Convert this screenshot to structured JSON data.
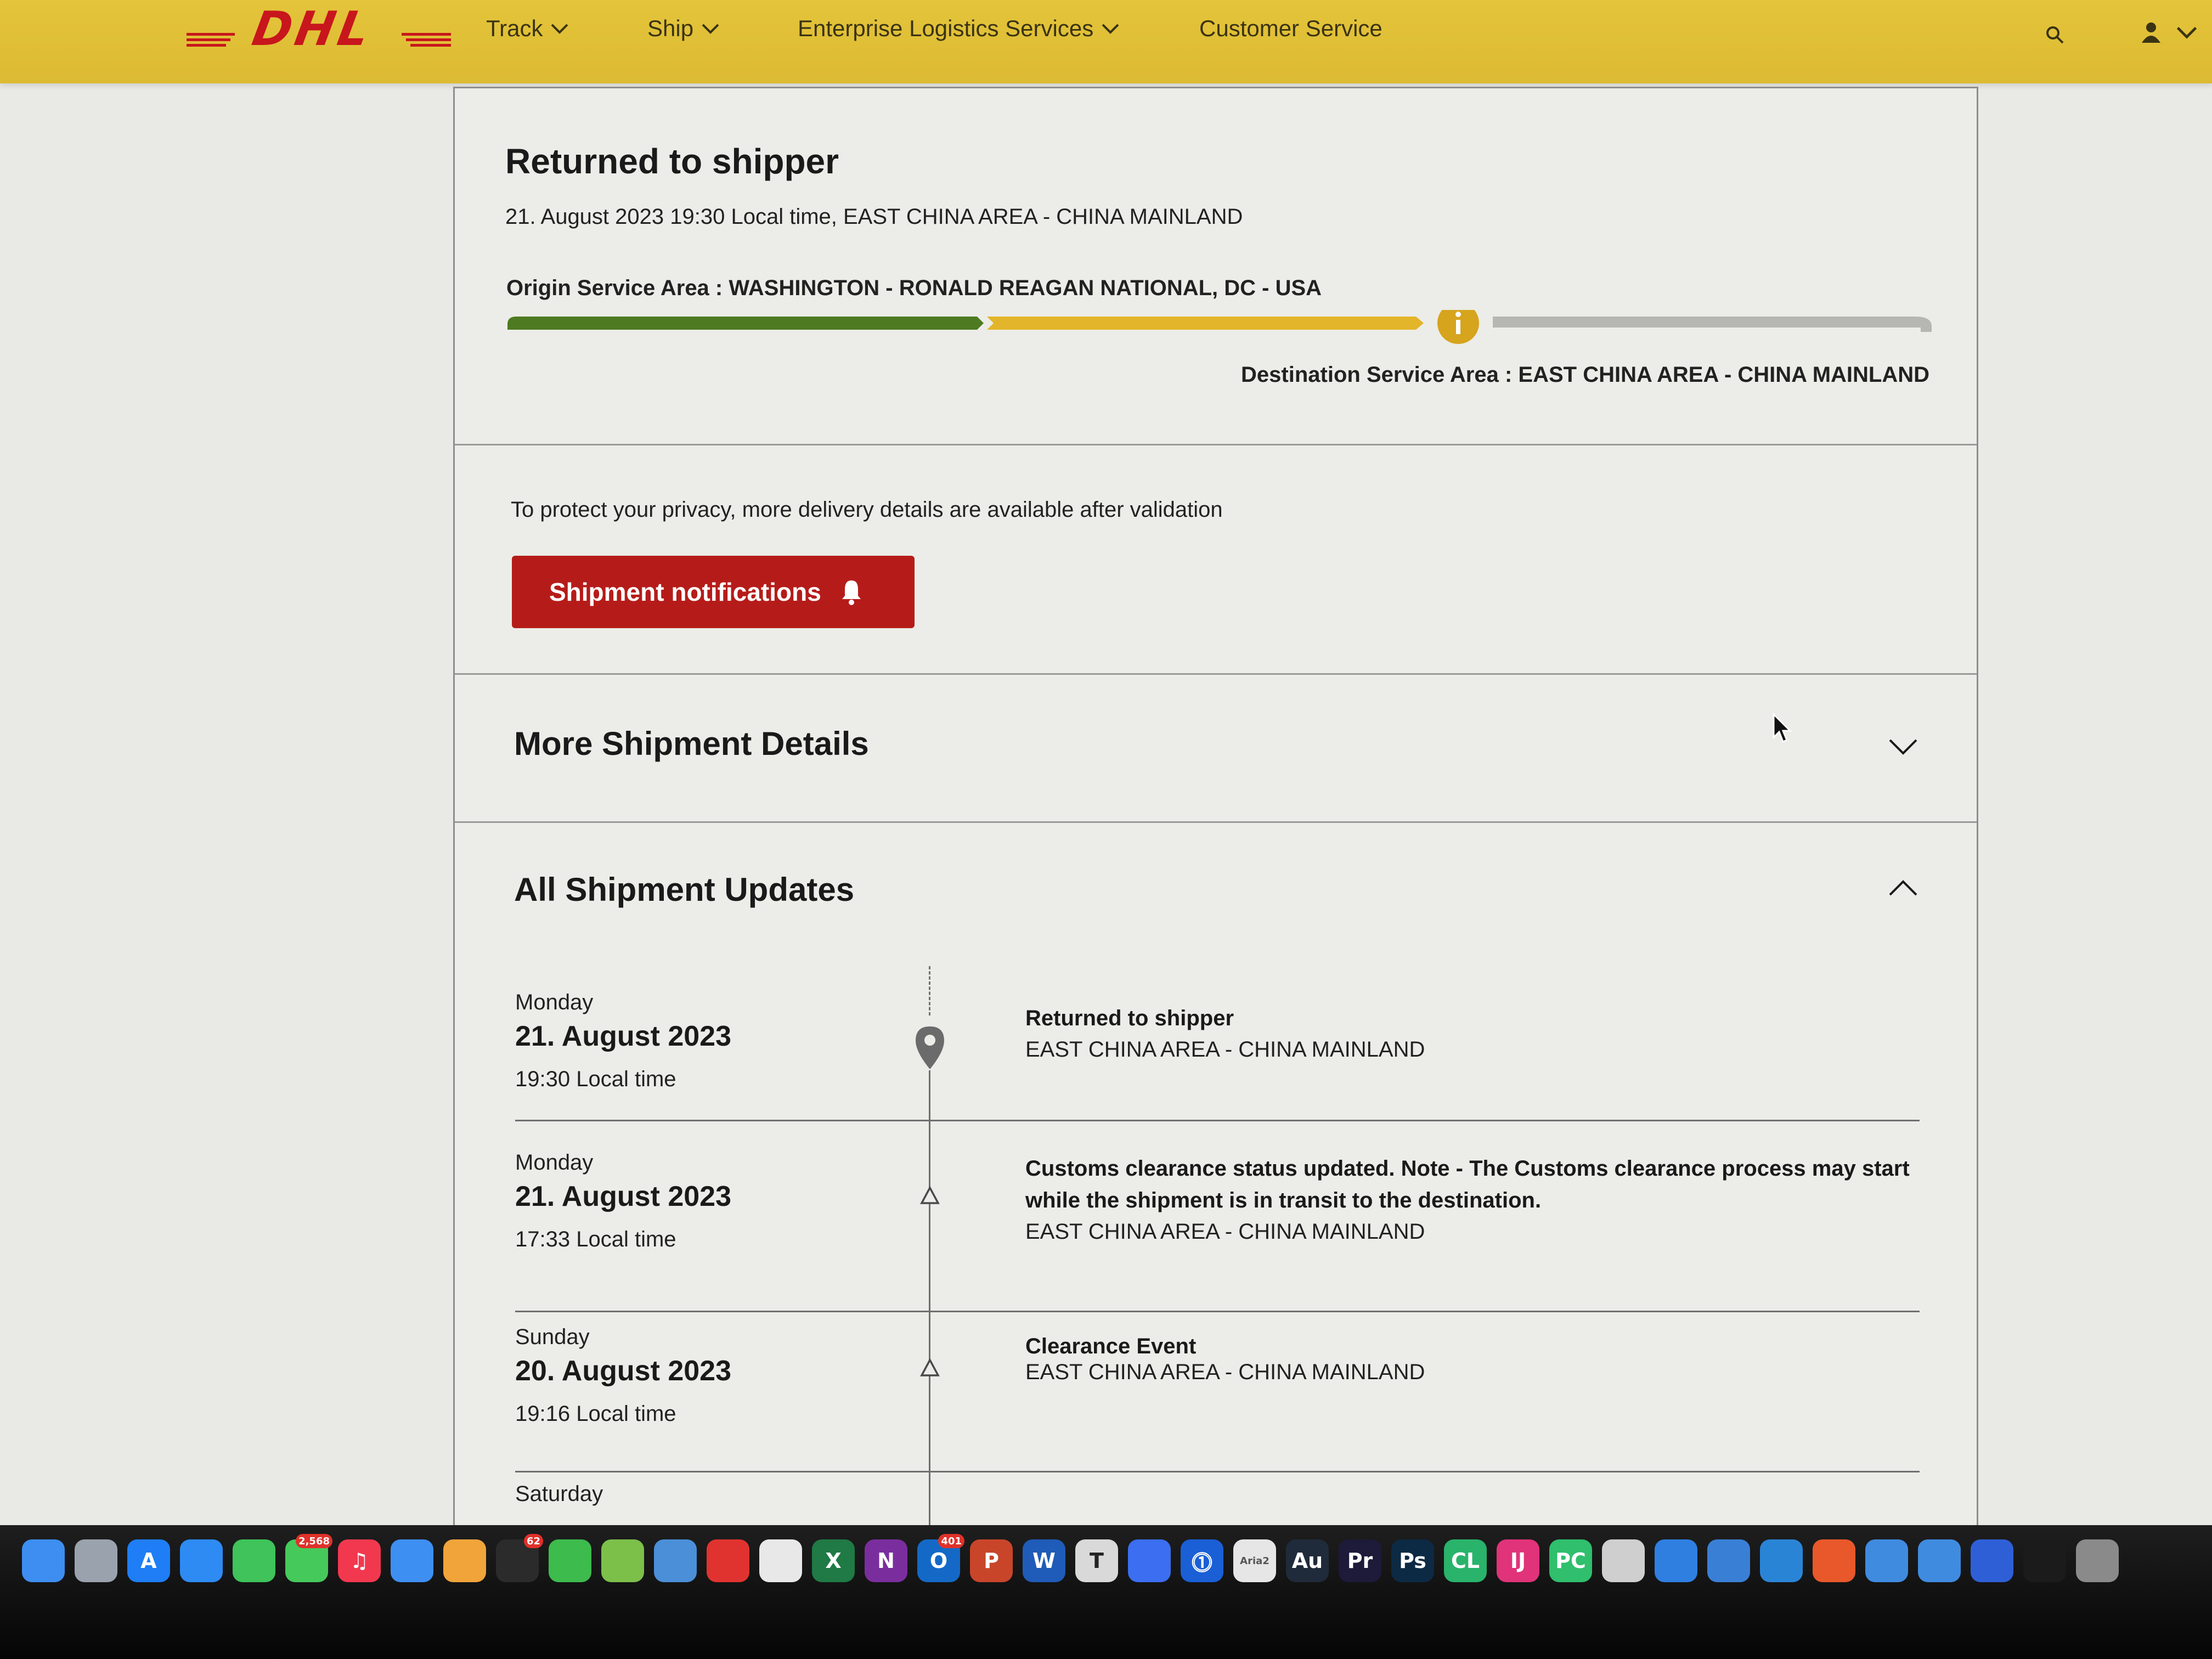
{
  "nav": {
    "logo_text": "DHL",
    "items": [
      {
        "label": "Track"
      },
      {
        "label": "Ship"
      },
      {
        "label": "Enterprise Logistics Services"
      },
      {
        "label": "Customer Service"
      }
    ]
  },
  "status": {
    "title": "Returned to shipper",
    "subtitle": "21. August 2023 19:30 Local time, EAST CHINA AREA - CHINA MAINLAND",
    "origin": "Origin Service Area : WASHINGTON - RONALD REAGAN NATIONAL, DC - USA",
    "destination": "Destination Service Area : EAST CHINA AREA - CHINA MAINLAND",
    "progress_segments": [
      "complete",
      "in-transit",
      "pending"
    ],
    "colors": {
      "complete": "#4e7a22",
      "in_transit": "#e3b52b",
      "pending": "#b6b6b3",
      "info": "#d6a41d"
    }
  },
  "privacy": {
    "text": "To protect your privacy, more delivery details are available after validation",
    "button_label": "Shipment notifications",
    "button_color": "#b51c19"
  },
  "sections": {
    "details_title": "More Shipment Details",
    "updates_title": "All Shipment Updates"
  },
  "events": [
    {
      "day": "Monday",
      "date": "21. August 2023",
      "time": "19:30 Local time",
      "title": "Returned to shipper",
      "location": "EAST CHINA AREA - CHINA MAINLAND",
      "icon": "location-pin-icon"
    },
    {
      "day": "Monday",
      "date": "21. August 2023",
      "time": "17:33 Local time",
      "title": "Customs clearance status updated. Note - The Customs clearance process may start while the shipment is in transit to the destination.",
      "location": "EAST CHINA AREA - CHINA MAINLAND",
      "icon": "triangle-icon"
    },
    {
      "day": "Sunday",
      "date": "20. August 2023",
      "time": "19:16 Local time",
      "title": "Clearance Event",
      "location": "EAST CHINA AREA - CHINA MAINLAND",
      "icon": "triangle-icon"
    },
    {
      "day": "Saturday",
      "date": "",
      "time": "",
      "title": "",
      "location": "",
      "icon": "triangle-icon"
    }
  ],
  "dock": {
    "apps": [
      {
        "name": "finder-icon",
        "color": "#3d8ef0",
        "glyph": ""
      },
      {
        "name": "launchpad-icon",
        "color": "#9aa3ad",
        "glyph": ""
      },
      {
        "name": "app-store-icon",
        "color": "#1f7ef5",
        "glyph": "A"
      },
      {
        "name": "safari-icon",
        "color": "#2d8bf3",
        "glyph": ""
      },
      {
        "name": "facetime-icon",
        "color": "#3fc35a",
        "glyph": ""
      },
      {
        "name": "messages-icon",
        "color": "#46c95b",
        "glyph": "",
        "badge": "2,568"
      },
      {
        "name": "music-icon",
        "color": "#f2384f",
        "glyph": "♫"
      },
      {
        "name": "mail-icon",
        "color": "#3e8ff2",
        "glyph": ""
      },
      {
        "name": "photos-icon",
        "color": "#f0a43a",
        "glyph": ""
      },
      {
        "name": "qq-icon",
        "color": "#2b2b2b",
        "glyph": "",
        "badge": "62"
      },
      {
        "name": "wechat-icon",
        "color": "#3dbb4d",
        "glyph": ""
      },
      {
        "name": "maps-icon",
        "color": "#7cc04a",
        "glyph": ""
      },
      {
        "name": "game-icon",
        "color": "#4a8fd8",
        "glyph": ""
      },
      {
        "name": "netease-music-icon",
        "color": "#e0332f",
        "glyph": ""
      },
      {
        "name": "chrome-icon",
        "color": "#e8e8e8",
        "glyph": ""
      },
      {
        "name": "excel-icon",
        "color": "#1f7a45",
        "glyph": "X"
      },
      {
        "name": "onenote-icon",
        "color": "#7a2e9e",
        "glyph": "N"
      },
      {
        "name": "outlook-icon",
        "color": "#1469c7",
        "glyph": "O",
        "badge": "401"
      },
      {
        "name": "powerpoint-icon",
        "color": "#c8452a",
        "glyph": "P"
      },
      {
        "name": "word-icon",
        "color": "#1f5bb8",
        "glyph": "W"
      },
      {
        "name": "typora-icon",
        "color": "#d9d9d9",
        "glyph": "T"
      },
      {
        "name": "pen-app-icon",
        "color": "#3b6ef0",
        "glyph": ""
      },
      {
        "name": "1password-icon",
        "color": "#1a5fd6",
        "glyph": "⓵"
      },
      {
        "name": "aria2-icon",
        "color": "#e6e6e6",
        "glyph": "Aria2"
      },
      {
        "name": "audition-icon",
        "color": "#1f2b3a",
        "glyph": "Au"
      },
      {
        "name": "premiere-icon",
        "color": "#1d1a3a",
        "glyph": "Pr"
      },
      {
        "name": "photoshop-icon",
        "color": "#0c2a44",
        "glyph": "Ps"
      },
      {
        "name": "clion-icon",
        "color": "#29b36b",
        "glyph": "CL"
      },
      {
        "name": "intellij-icon",
        "color": "#e0337a",
        "glyph": "IJ"
      },
      {
        "name": "pycharm-icon",
        "color": "#2fbf6d",
        "glyph": "PC"
      },
      {
        "name": "notes-app-icon",
        "color": "#cfcfcf",
        "glyph": ""
      },
      {
        "name": "xcode-icon",
        "color": "#2f7fe0",
        "glyph": ""
      },
      {
        "name": "remote-desktop-icon",
        "color": "#3a7fd6",
        "glyph": ""
      },
      {
        "name": "vscode-icon",
        "color": "#2a84d6",
        "glyph": ""
      },
      {
        "name": "office-icon",
        "color": "#e8582a",
        "glyph": ""
      },
      {
        "name": "folder-icon",
        "color": "#3f8be0",
        "glyph": ""
      },
      {
        "name": "activity-icon",
        "color": "#3f8be0",
        "glyph": ""
      },
      {
        "name": "screenshot-icon",
        "color": "#2f5fd6",
        "glyph": ""
      },
      {
        "name": "terminal-icon",
        "color": "#1b1b1b",
        "glyph": ""
      },
      {
        "name": "system-prefs-icon",
        "color": "#8a8a8a",
        "glyph": ""
      }
    ]
  }
}
